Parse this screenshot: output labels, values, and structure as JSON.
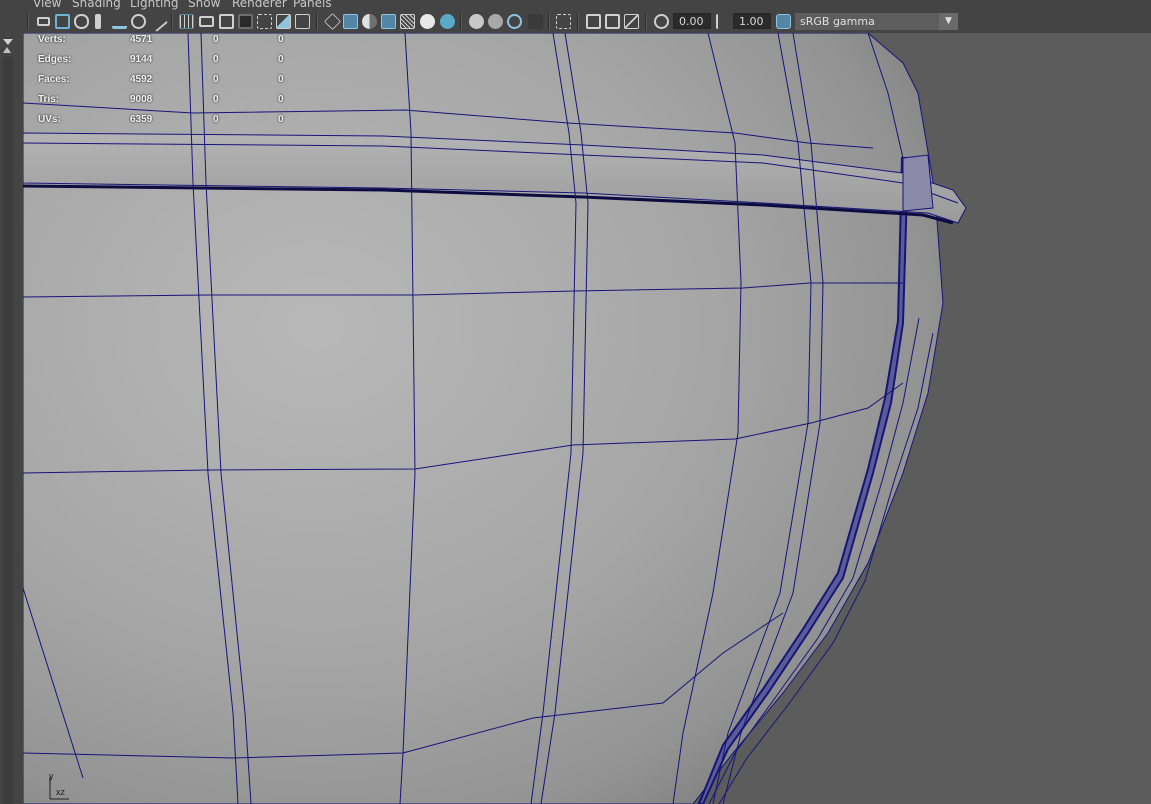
{
  "menu": [
    "View",
    "Shading",
    "Lighting",
    "Show",
    "Renderer",
    "Panels"
  ],
  "toolbar": {
    "icons": [
      "select-camera-icon",
      "camera-attributes-icon",
      "bookmark-icon",
      "image-plane-icon",
      "grease-pencil-icon",
      "2d-pan-zoom-icon",
      "grid-icon",
      "film-gate-icon",
      "resolution-gate-icon",
      "gate-mask-icon",
      "field-chart-icon",
      "safe-action-icon",
      "safe-title-icon",
      "wireframe-icon",
      "smooth-shade-icon",
      "use-default-material-icon",
      "wireframe-on-shaded-icon",
      "xray-icon",
      "lights-icon",
      "shadows-icon",
      "ambient-occlusion-icon",
      "motion-blur-icon",
      "anti-aliasing-icon",
      "depth-of-field-icon",
      "isolate-select-icon",
      "xray-joints-icon",
      "xray-active-icon",
      "backface-culling-icon",
      "exposure-icon",
      "gamma-icon",
      "color-management-icon"
    ],
    "exposure_value": "0.00",
    "gamma_value": "1.00",
    "color_space": "sRGB gamma",
    "accent": "#5285a6"
  },
  "hud": {
    "rows": [
      {
        "label": "Verts:",
        "a": "4571",
        "b": "0",
        "c": "0"
      },
      {
        "label": "Edges:",
        "a": "9144",
        "b": "0",
        "c": "0"
      },
      {
        "label": "Faces:",
        "a": "4592",
        "b": "0",
        "c": "0"
      },
      {
        "label": "Tris:",
        "a": "9008",
        "b": "0",
        "c": "0"
      },
      {
        "label": "UVs:",
        "a": "6359",
        "b": "0",
        "c": "0"
      }
    ]
  },
  "axis": {
    "y": "y",
    "xz": "xz"
  },
  "colors": {
    "wire": "#15157a",
    "mesh_light": "#b3b3b3",
    "mesh_dark": "#8a8a8a",
    "background": "#5c5c5c"
  }
}
